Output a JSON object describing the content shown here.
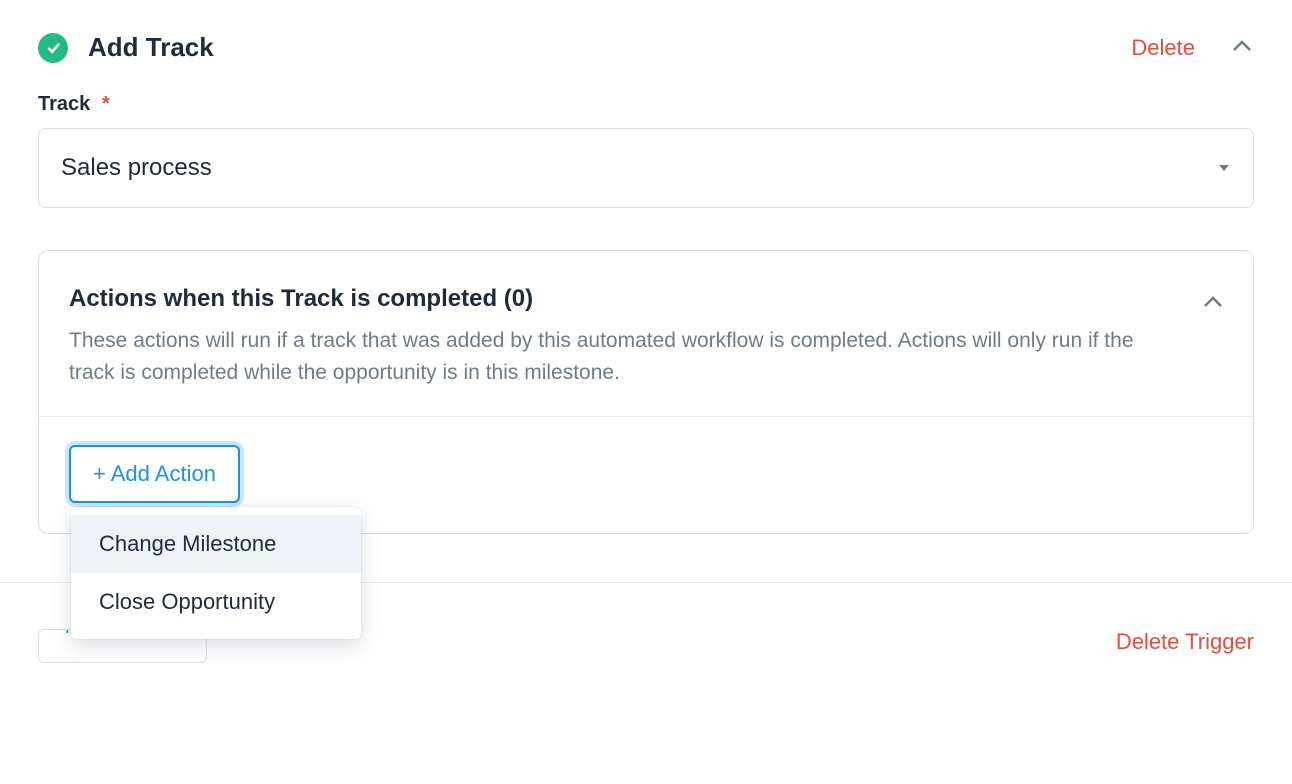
{
  "header": {
    "title": "Add Track",
    "delete_label": "Delete"
  },
  "track_field": {
    "label": "Track",
    "required_marker": "*",
    "value": "Sales process"
  },
  "actions_panel": {
    "title": "Actions when this Track is completed (0)",
    "description": "These actions will run if a track that was added by this automated workflow is completed. Actions will only run if the track is completed while the opportunity is in this milestone.",
    "add_button_label": "+ Add Action"
  },
  "action_dropdown": {
    "items": [
      {
        "label": "Change Milestone",
        "highlighted": true
      },
      {
        "label": "Close Opportunity",
        "highlighted": false
      }
    ]
  },
  "footer": {
    "add_button_label": "+ Add Action",
    "delete_trigger_label": "Delete Trigger"
  },
  "colors": {
    "accent": "#1a92ec",
    "danger": "#e74c3c",
    "success": "#25b989"
  }
}
